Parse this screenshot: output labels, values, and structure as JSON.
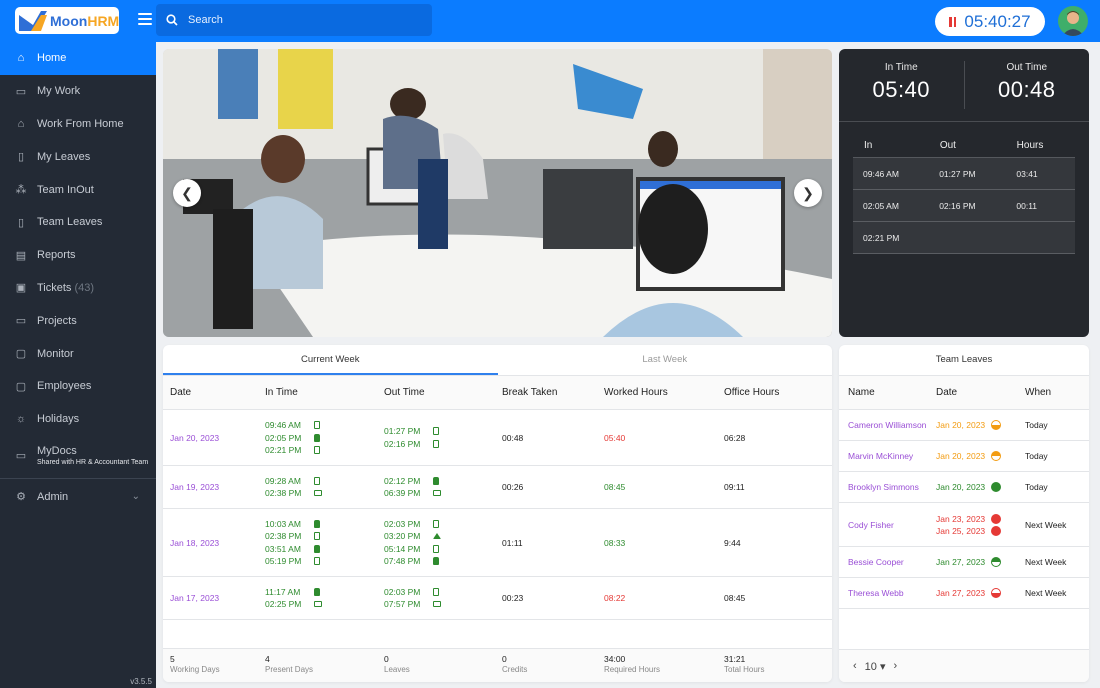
{
  "app": {
    "name_a": "Moon",
    "name_b": "HRM"
  },
  "header": {
    "search_placeholder": "Search",
    "timer": "05:40:27",
    "icons": {
      "menu": "hamburger-icon",
      "search": "search-icon",
      "pause": "pause-icon",
      "avatar": "user-avatar"
    }
  },
  "sidebar": {
    "items": [
      {
        "label": "Home",
        "icon": "home-icon",
        "active": true
      },
      {
        "label": "My Work",
        "icon": "briefcase-icon"
      },
      {
        "label": "Work From Home",
        "icon": "house-icon"
      },
      {
        "label": "My Leaves",
        "icon": "exit-door-icon"
      },
      {
        "label": "Team InOut",
        "icon": "team-icon"
      },
      {
        "label": "Team Leaves",
        "icon": "exit-door-icon"
      },
      {
        "label": "Reports",
        "icon": "document-icon"
      },
      {
        "label": "Tickets",
        "count": "(43)",
        "icon": "ticket-icon"
      },
      {
        "label": "Projects",
        "icon": "folder-icon"
      },
      {
        "label": "Monitor",
        "icon": "monitor-icon"
      },
      {
        "label": "Employees",
        "icon": "employee-monitor-icon"
      },
      {
        "label": "Holidays",
        "icon": "beach-icon"
      },
      {
        "label": "MyDocs",
        "sub": "Shared with HR & Accountant Team",
        "icon": "folder-icon"
      }
    ],
    "admin": {
      "label": "Admin",
      "icon": "gear-icon"
    },
    "version": "v3.5.5"
  },
  "hero": {
    "alt": "Office workspace photo carousel",
    "prev_icon": "chevron-left-icon",
    "next_icon": "chevron-right-icon"
  },
  "inout": {
    "in_time_label": "In  Time",
    "in_time": "05:40",
    "out_time_label": "Out Time",
    "out_time": "00:48",
    "columns": [
      "In",
      "Out",
      "Hours"
    ],
    "rows": [
      {
        "in": "09:46 AM",
        "out": "01:27 PM",
        "hours": "03:41"
      },
      {
        "in": "02:05 AM",
        "out": "02:16 PM",
        "hours": "00:11"
      },
      {
        "in": "02:21 PM",
        "out": "",
        "hours": ""
      }
    ]
  },
  "week": {
    "tabs": [
      "Current Week",
      "Last Week"
    ],
    "columns": [
      "Date",
      "In Time",
      "Out Time",
      "Break Taken",
      "Worked Hours",
      "Office Hours"
    ],
    "rows": [
      {
        "date": "Jan 20, 2023",
        "in": [
          {
            "t": "09:46 AM",
            "i": "door"
          },
          {
            "t": "02:05 PM",
            "i": "hand"
          },
          {
            "t": "02:21 PM",
            "i": "door"
          }
        ],
        "out": [
          {
            "t": "01:27 PM",
            "i": "door"
          },
          {
            "t": "02:16 PM",
            "i": "door"
          }
        ],
        "break": "00:48",
        "worked": "05:40",
        "worked_status": "red",
        "office": "06:28"
      },
      {
        "date": "Jan 19, 2023",
        "in": [
          {
            "t": "09:28 AM",
            "i": "door"
          },
          {
            "t": "02:38 PM",
            "i": "pc"
          }
        ],
        "out": [
          {
            "t": "02:12 PM",
            "i": "hand"
          },
          {
            "t": "06:39 PM",
            "i": "pc"
          }
        ],
        "break": "00:26",
        "worked": "08:45",
        "worked_status": "green",
        "office": "09:11"
      },
      {
        "date": "Jan 18, 2023",
        "in": [
          {
            "t": "10:03 AM",
            "i": "hand"
          },
          {
            "t": "02:38 PM",
            "i": "door"
          },
          {
            "t": "03:51 AM",
            "i": "hand"
          },
          {
            "t": "05:19 PM",
            "i": "door"
          }
        ],
        "out": [
          {
            "t": "02:03 PM",
            "i": "door"
          },
          {
            "t": "03:20 PM",
            "i": "net"
          },
          {
            "t": "05:14 PM",
            "i": "door"
          },
          {
            "t": "07:48 PM",
            "i": "hand"
          }
        ],
        "break": "01:11",
        "worked": "08:33",
        "worked_status": "green",
        "office": "9:44"
      },
      {
        "date": "Jan 17, 2023",
        "in": [
          {
            "t": "11:17 AM",
            "i": "hand"
          },
          {
            "t": "02:25 PM",
            "i": "pc"
          }
        ],
        "out": [
          {
            "t": "02:03 PM",
            "i": "door"
          },
          {
            "t": "07:57 PM",
            "i": "pc"
          }
        ],
        "break": "00:23",
        "worked": "08:22",
        "worked_status": "red",
        "office": "08:45"
      }
    ],
    "summary": [
      {
        "value": "5",
        "label": "Working Days"
      },
      {
        "value": "4",
        "label": "Present Days"
      },
      {
        "value": "0",
        "label": "Leaves"
      },
      {
        "value": "0",
        "label": "Credits"
      },
      {
        "value": "34:00",
        "label": "Required Hours"
      },
      {
        "value": "31:21",
        "label": "Total Hours"
      }
    ]
  },
  "team_leaves": {
    "title": "Team Leaves",
    "columns": [
      "Name",
      "Date",
      "When"
    ],
    "rows": [
      {
        "name": "Cameron Williamson",
        "dates": [
          {
            "d": "Jan 20, 2023",
            "c": "orange",
            "type": "half-bottom"
          }
        ],
        "when": "Today"
      },
      {
        "name": "Marvin McKinney",
        "dates": [
          {
            "d": "Jan 20, 2023",
            "c": "orange",
            "type": "half-top"
          }
        ],
        "when": "Today"
      },
      {
        "name": "Brooklyn Simmons",
        "dates": [
          {
            "d": "Jan 20, 2023",
            "c": "green",
            "type": "full"
          }
        ],
        "when": "Today"
      },
      {
        "name": "Cody Fisher",
        "dates": [
          {
            "d": "Jan 23, 2023",
            "c": "red",
            "type": "full"
          },
          {
            "d": "Jan 25, 2023",
            "c": "red",
            "type": "full"
          }
        ],
        "when": "Next Week"
      },
      {
        "name": "Bessie Cooper",
        "dates": [
          {
            "d": "Jan 27, 2023",
            "c": "green",
            "type": "half-top"
          }
        ],
        "when": "Next Week"
      },
      {
        "name": "Theresa Webb",
        "dates": [
          {
            "d": "Jan 27, 2023",
            "c": "red",
            "type": "half-bottom"
          }
        ],
        "when": "Next Week"
      }
    ],
    "pager": {
      "prev": "‹",
      "size": "10",
      "next": "›"
    }
  },
  "colors": {
    "accent": "#0b7cff",
    "sidebar": "#232a35",
    "purple": "#9a4fd6",
    "green": "#2e8b2e",
    "red": "#e53935",
    "orange": "#f39c12"
  }
}
